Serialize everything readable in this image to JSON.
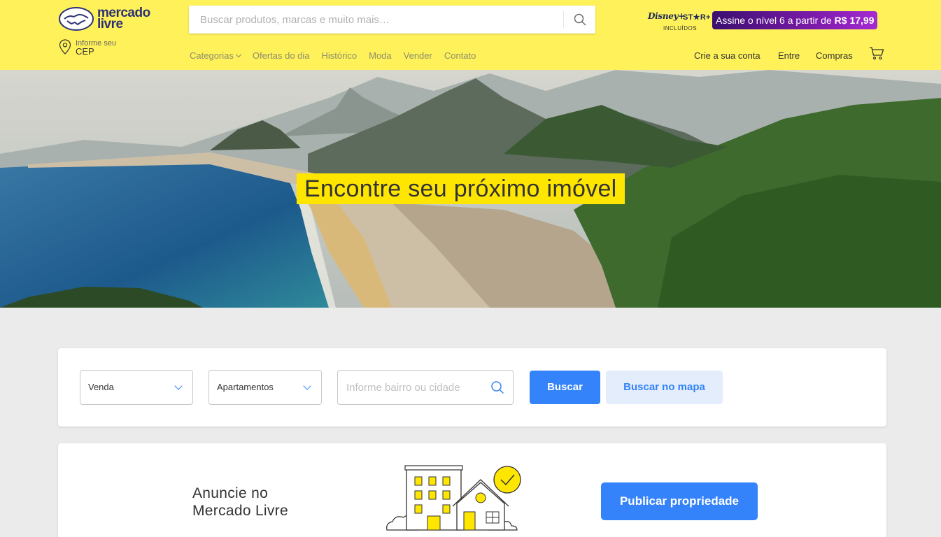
{
  "header": {
    "logo_text_line1": "mercado",
    "logo_text_line2": "livre",
    "search_placeholder": "Buscar produtos, marcas e muito mais…",
    "cep_label": "Informe seu",
    "cep_value": "CEP",
    "disney_title": "Disney+",
    "star_title": "ST★R+",
    "disney_sub": "INCLUÍDOS",
    "promo_text": "Assine o nível 6 a partir de",
    "promo_price": "R$ 17,99",
    "nav": {
      "categorias": "Categorias",
      "ofertas": "Ofertas do dia",
      "historico": "Histórico",
      "moda": "Moda",
      "vender": "Vender",
      "contato": "Contato"
    },
    "user_nav": {
      "crie_conta": "Crie a sua conta",
      "entre": "Entre",
      "compras": "Compras"
    }
  },
  "hero": {
    "title": "Encontre seu próximo imóvel"
  },
  "filters": {
    "operation": "Venda",
    "property_type": "Apartamentos",
    "location_placeholder": "Informe bairro ou cidade",
    "search_button": "Buscar",
    "map_button": "Buscar no mapa"
  },
  "advertise": {
    "title_line1": "Anuncie no",
    "title_line2": "Mercado Livre",
    "button": "Publicar propriedade"
  },
  "colors": {
    "brand_yellow": "#fff159",
    "primary_blue": "#3483fa",
    "secondary_blue_bg": "#e3edfb",
    "logo_navy": "#2d3277",
    "hero_highlight": "#ffe600"
  }
}
